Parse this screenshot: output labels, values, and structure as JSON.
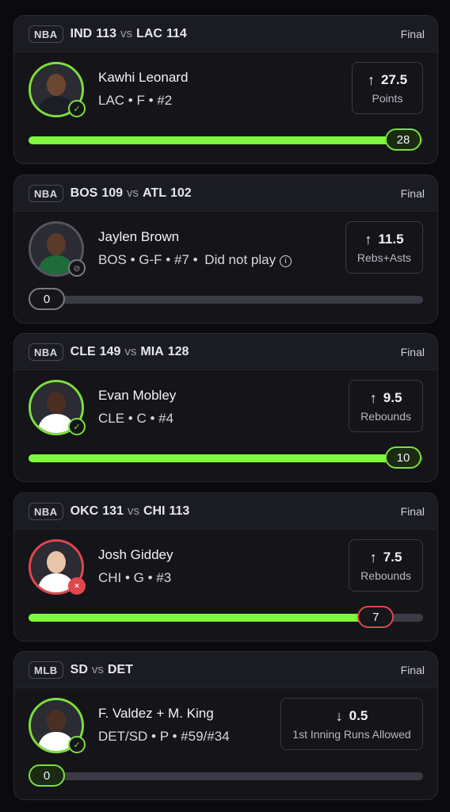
{
  "cards": [
    {
      "league": "NBA",
      "away_team": "IND",
      "away_score": "113",
      "vs": "vs",
      "home_team": "LAC",
      "home_score": "114",
      "status": "Final",
      "player_name": "Kawhi Leonard",
      "player_meta": "LAC • F • #2",
      "dnp": "",
      "line_direction": "↑",
      "line_value": "27.5",
      "stat": "Points",
      "result": "28",
      "progress": 1.0,
      "result_state": "hit"
    },
    {
      "league": "NBA",
      "away_team": "BOS",
      "away_score": "109",
      "vs": "vs",
      "home_team": "ATL",
      "home_score": "102",
      "status": "Final",
      "player_name": "Jaylen Brown",
      "player_meta": "BOS • G-F • #7 •",
      "dnp": "Did not play",
      "line_direction": "↑",
      "line_value": "11.5",
      "stat": "Rebs+Asts",
      "result": "0",
      "progress": 0.0,
      "result_state": "void"
    },
    {
      "league": "NBA",
      "away_team": "CLE",
      "away_score": "149",
      "vs": "vs",
      "home_team": "MIA",
      "home_score": "128",
      "status": "Final",
      "player_name": "Evan Mobley",
      "player_meta": "CLE • C • #4",
      "dnp": "",
      "line_direction": "↑",
      "line_value": "9.5",
      "stat": "Rebounds",
      "result": "10",
      "progress": 1.0,
      "result_state": "hit"
    },
    {
      "league": "NBA",
      "away_team": "OKC",
      "away_score": "131",
      "vs": "vs",
      "home_team": "CHI",
      "home_score": "113",
      "status": "Final",
      "player_name": "Josh Giddey",
      "player_meta": "CHI • G • #3",
      "dnp": "",
      "line_direction": "↑",
      "line_value": "7.5",
      "stat": "Rebounds",
      "result": "7",
      "progress": 0.93,
      "result_state": "miss"
    },
    {
      "league": "MLB",
      "away_team": "SD",
      "away_score": "",
      "vs": "vs",
      "home_team": "DET",
      "home_score": "",
      "status": "Final",
      "player_name": "F. Valdez + M. King",
      "player_meta": "DET/SD • P • #59/#34",
      "dnp": "",
      "line_direction": "↓",
      "line_value": "0.5",
      "stat": "1st Inning Runs Allowed",
      "result": "0",
      "progress": 0.0,
      "result_state": "hit"
    }
  ],
  "colors": {
    "hit": "#7dde3c",
    "miss": "#e0474c",
    "void": "#7a7a85",
    "fill": "#7dfa3b"
  }
}
